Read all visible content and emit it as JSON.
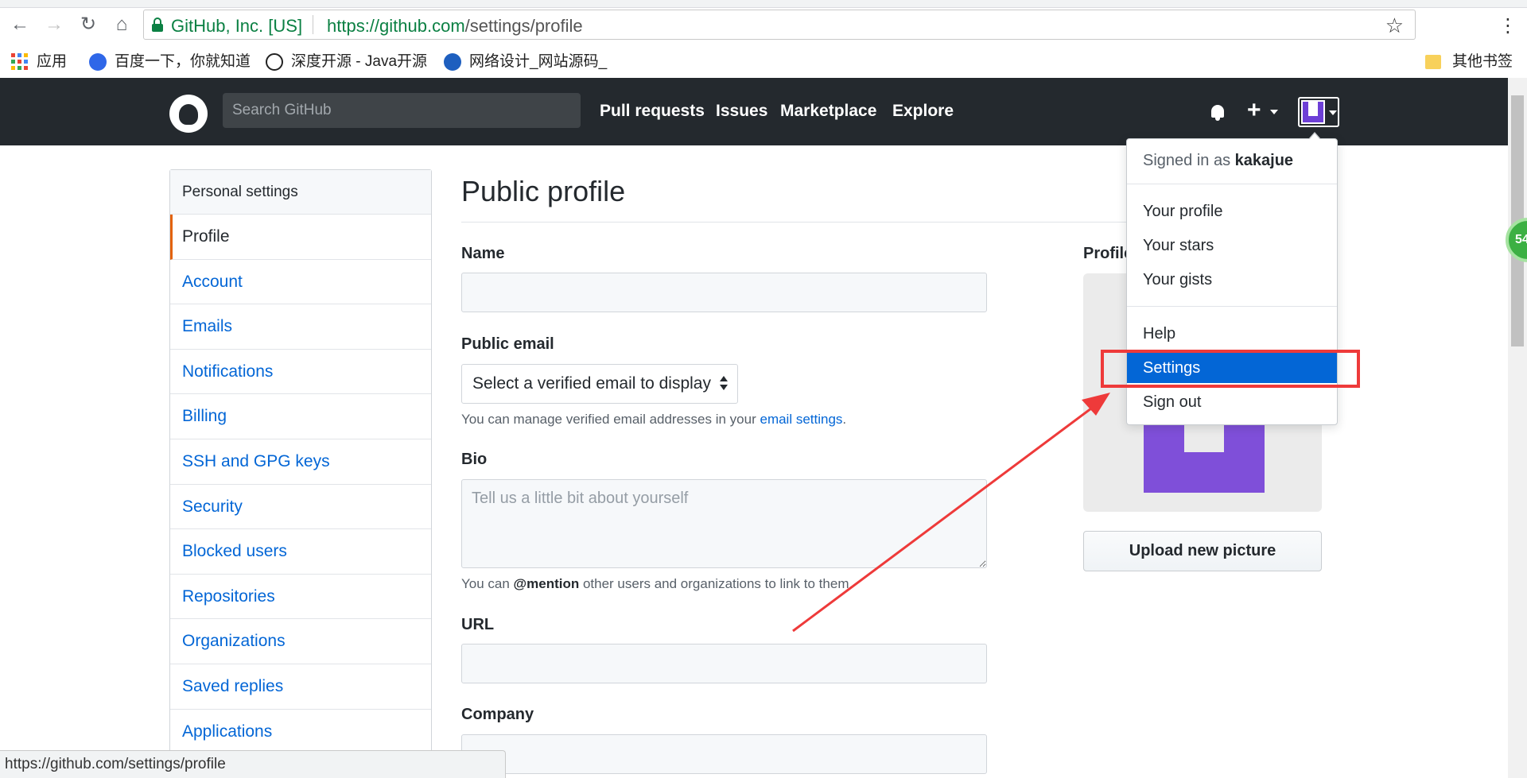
{
  "browser": {
    "site_name": "GitHub, Inc. [US]",
    "url_scheme_host": "https://github.com",
    "url_path": "/settings/profile",
    "bookmarks": [
      {
        "label": "应用"
      },
      {
        "label": "百度一下，你就知道"
      },
      {
        "label": "深度开源 - Java开源"
      },
      {
        "label": "网络设计_网站源码_"
      }
    ],
    "bookmarks_other": "其他书签",
    "status_url": "https://github.com/settings/profile"
  },
  "header": {
    "search_placeholder": "Search GitHub",
    "nav": [
      "Pull requests",
      "Issues",
      "Marketplace",
      "Explore"
    ]
  },
  "sidebar": {
    "heading": "Personal settings",
    "items": [
      {
        "label": "Profile"
      },
      {
        "label": "Account"
      },
      {
        "label": "Emails"
      },
      {
        "label": "Notifications"
      },
      {
        "label": "Billing"
      },
      {
        "label": "SSH and GPG keys"
      },
      {
        "label": "Security"
      },
      {
        "label": "Blocked users"
      },
      {
        "label": "Repositories"
      },
      {
        "label": "Organizations"
      },
      {
        "label": "Saved replies"
      },
      {
        "label": "Applications"
      }
    ]
  },
  "main": {
    "title": "Public profile",
    "name_label": "Name",
    "name_value": "",
    "email_label": "Public email",
    "email_select": "Select a verified email to display",
    "email_note_prefix": "You can manage verified email addresses in your ",
    "email_note_link": "email settings",
    "email_note_suffix": ".",
    "bio_label": "Bio",
    "bio_placeholder": "Tell us a little bit about yourself",
    "bio_note_prefix": "You can ",
    "bio_note_mention": "@mention",
    "bio_note_suffix": " other users and organizations to link to them.",
    "url_label": "URL",
    "url_value": "",
    "company_label": "Company",
    "company_value": ""
  },
  "profile_picture": {
    "label": "Profile picture",
    "upload_label": "Upload new picture"
  },
  "dropdown": {
    "signed_in_prefix": "Signed in as ",
    "username": "kakajue",
    "items": [
      {
        "label": "Your profile"
      },
      {
        "label": "Your stars"
      },
      {
        "label": "Your gists"
      },
      {
        "label": "Help"
      },
      {
        "label": "Settings"
      },
      {
        "label": "Sign out"
      }
    ]
  },
  "badge_text": "54",
  "colors": {
    "header_bg": "#24292e",
    "link": "#0366d6",
    "highlight": "#0366d6",
    "annotation_red": "#ee3a3a",
    "avatar_purple": "#7f4fd9"
  }
}
